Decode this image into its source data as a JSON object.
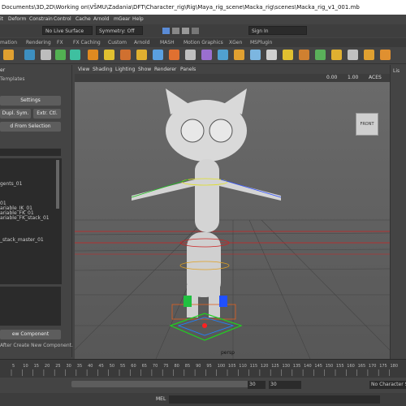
{
  "window": {
    "title": "Documents\\3D,2D\\Working on\\VŠMU\\Zadania\\DFT\\Character_rig\\Rig\\Maya_rig_scene\\Macka_rig\\scenes\\Macka_rig_v1_001.mb"
  },
  "menubar": {
    "items": [
      "it",
      "Deform",
      "Constrain",
      "Control",
      "Cache",
      "Arnold",
      "mGear",
      "Help"
    ]
  },
  "statusline": {
    "live_surface": "No Live Surface",
    "symmetry": "Symmetry: Off",
    "sign_in": "Sign In"
  },
  "shelf_tabs": [
    "mation",
    "Rendering",
    "FX",
    "FX Caching",
    "Custom",
    "Arnold",
    "MASH",
    "Motion Graphics",
    "XGen",
    "MSPlugin"
  ],
  "left_panel": {
    "header_fragment": "er",
    "subheader_fragment": "Templates",
    "settings_button": "Settings",
    "dupl_sym_button": "Dupl. Sym.",
    "extr_ctl_button": "Extr. Ctl.",
    "from_selection_button": "d From Selection",
    "list_items": [
      "gents_01",
      "01",
      "ariable_IK_01",
      "ariable_FK_01",
      "ariable_FK_stack_01",
      "_stack_master_01"
    ],
    "new_component_button": "ew Component",
    "after_create_text": "After Create New Component."
  },
  "viewport": {
    "menu": [
      "View",
      "Shading",
      "Lighting",
      "Show",
      "Renderer",
      "Panels"
    ],
    "view_cube_label": "FRONT",
    "camera_label": "persp",
    "field_values": [
      "0.00",
      "1.00"
    ],
    "color_space": "ACES"
  },
  "right_panel_label": "Lis",
  "timeline": {
    "ticks": [
      "5",
      "10",
      "15",
      "20",
      "25",
      "30",
      "35",
      "40",
      "45",
      "50",
      "55",
      "60",
      "65",
      "70",
      "75",
      "80",
      "85",
      "90",
      "95",
      "100",
      "105",
      "110",
      "115",
      "120",
      "125",
      "130",
      "135",
      "140",
      "145",
      "150",
      "155",
      "160",
      "165",
      "170",
      "175",
      "180"
    ]
  },
  "range": {
    "start_field": "30",
    "end_field": "30",
    "char_set": "No Character Se"
  },
  "command_line": {
    "label": "MEL"
  }
}
